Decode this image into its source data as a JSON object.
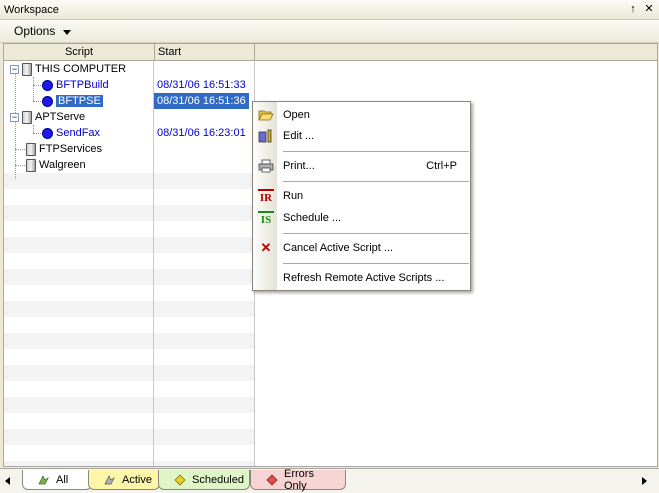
{
  "window": {
    "title": "Workspace",
    "pin_glyph": "↑",
    "close_glyph": "✕"
  },
  "toolbar": {
    "options_label": "Options"
  },
  "columns": [
    "Script",
    "Start"
  ],
  "rows": [
    {
      "name": "THIS COMPUTER",
      "start": "",
      "kind": "computer",
      "expander": "−"
    },
    {
      "name": "BFTPBuild",
      "start": "08/31/06 16:51:33",
      "kind": "script"
    },
    {
      "name": "BFTPSE",
      "start": "08/31/06 16:51:36",
      "kind": "script",
      "selected": true
    },
    {
      "name": "APTServe",
      "start": "",
      "kind": "computer",
      "expander": "−"
    },
    {
      "name": "SendFax",
      "start": "08/31/06 16:23:01",
      "kind": "script"
    },
    {
      "name": "FTPServices",
      "start": "",
      "kind": "computer"
    },
    {
      "name": "Walgreen",
      "start": "",
      "kind": "computer"
    }
  ],
  "context_menu": {
    "items": [
      {
        "label": "Open",
        "shortcut": "",
        "icon": "folder-open-icon"
      },
      {
        "label": "Edit ...",
        "shortcut": "",
        "icon": "edit-icon"
      },
      {
        "label": "Print...",
        "shortcut": "Ctrl+P",
        "icon": "printer-icon"
      },
      {
        "label": "Run",
        "shortcut": "",
        "icon": "run-icon"
      },
      {
        "label": "Schedule ...",
        "shortcut": "",
        "icon": "schedule-icon"
      },
      {
        "label": "Cancel Active Script ...",
        "shortcut": "",
        "icon": "cancel-icon"
      },
      {
        "label": "Refresh Remote Active Scripts ...",
        "shortcut": "",
        "icon": "refresh-icon"
      }
    ],
    "icon_glyphs": {
      "run": "IR",
      "schedule": "IS",
      "cancel": "✕"
    }
  },
  "tabs": [
    {
      "label": "All",
      "color": "#ffffff",
      "icon": "all-icon"
    },
    {
      "label": "Active",
      "color": "#fdf5a8",
      "icon": "active-icon"
    },
    {
      "label": "Scheduled",
      "color": "#dff5c8",
      "icon": "scheduled-icon"
    },
    {
      "label": "Errors Only",
      "color": "#f7d4d4",
      "icon": "errors-icon"
    }
  ],
  "colors": {
    "selection": "#316ac5",
    "script_text": "#0000cc",
    "menu_border": "#8a867a"
  }
}
